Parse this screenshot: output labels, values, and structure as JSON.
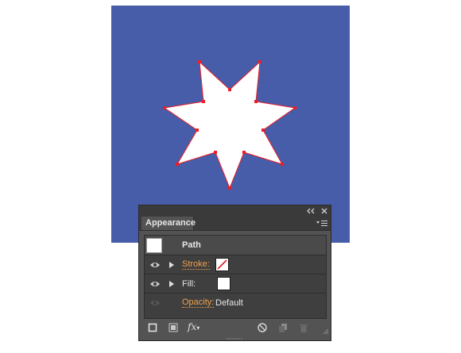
{
  "colors": {
    "artboard": "#475da9",
    "star_fill": "#ffffff",
    "anchor": "#ee1c24",
    "panel_bg": "#535353",
    "accent": "#f2a04a"
  },
  "panel": {
    "tab_label": "Appearance",
    "collapse_icon": "double-chevron-left-icon",
    "close_icon": "close-icon",
    "menu_icon": "panel-menu-icon",
    "header": {
      "title": "Path"
    },
    "rows": [
      {
        "label": "Stroke:",
        "value_type": "swatch-none",
        "expanded": false,
        "visible": true
      },
      {
        "label": "Fill:",
        "value_type": "swatch-white",
        "expanded": false,
        "visible": true
      },
      {
        "label": "Opacity:",
        "value": "Default",
        "visible": false
      }
    ],
    "footer": {
      "add_stroke_icon": "add-new-stroke-icon",
      "add_fill_icon": "add-new-fill-icon",
      "fx_label": "fx",
      "clear_icon": "clear-appearance-icon",
      "duplicate_icon": "duplicate-item-icon",
      "delete_icon": "delete-item-icon"
    }
  }
}
